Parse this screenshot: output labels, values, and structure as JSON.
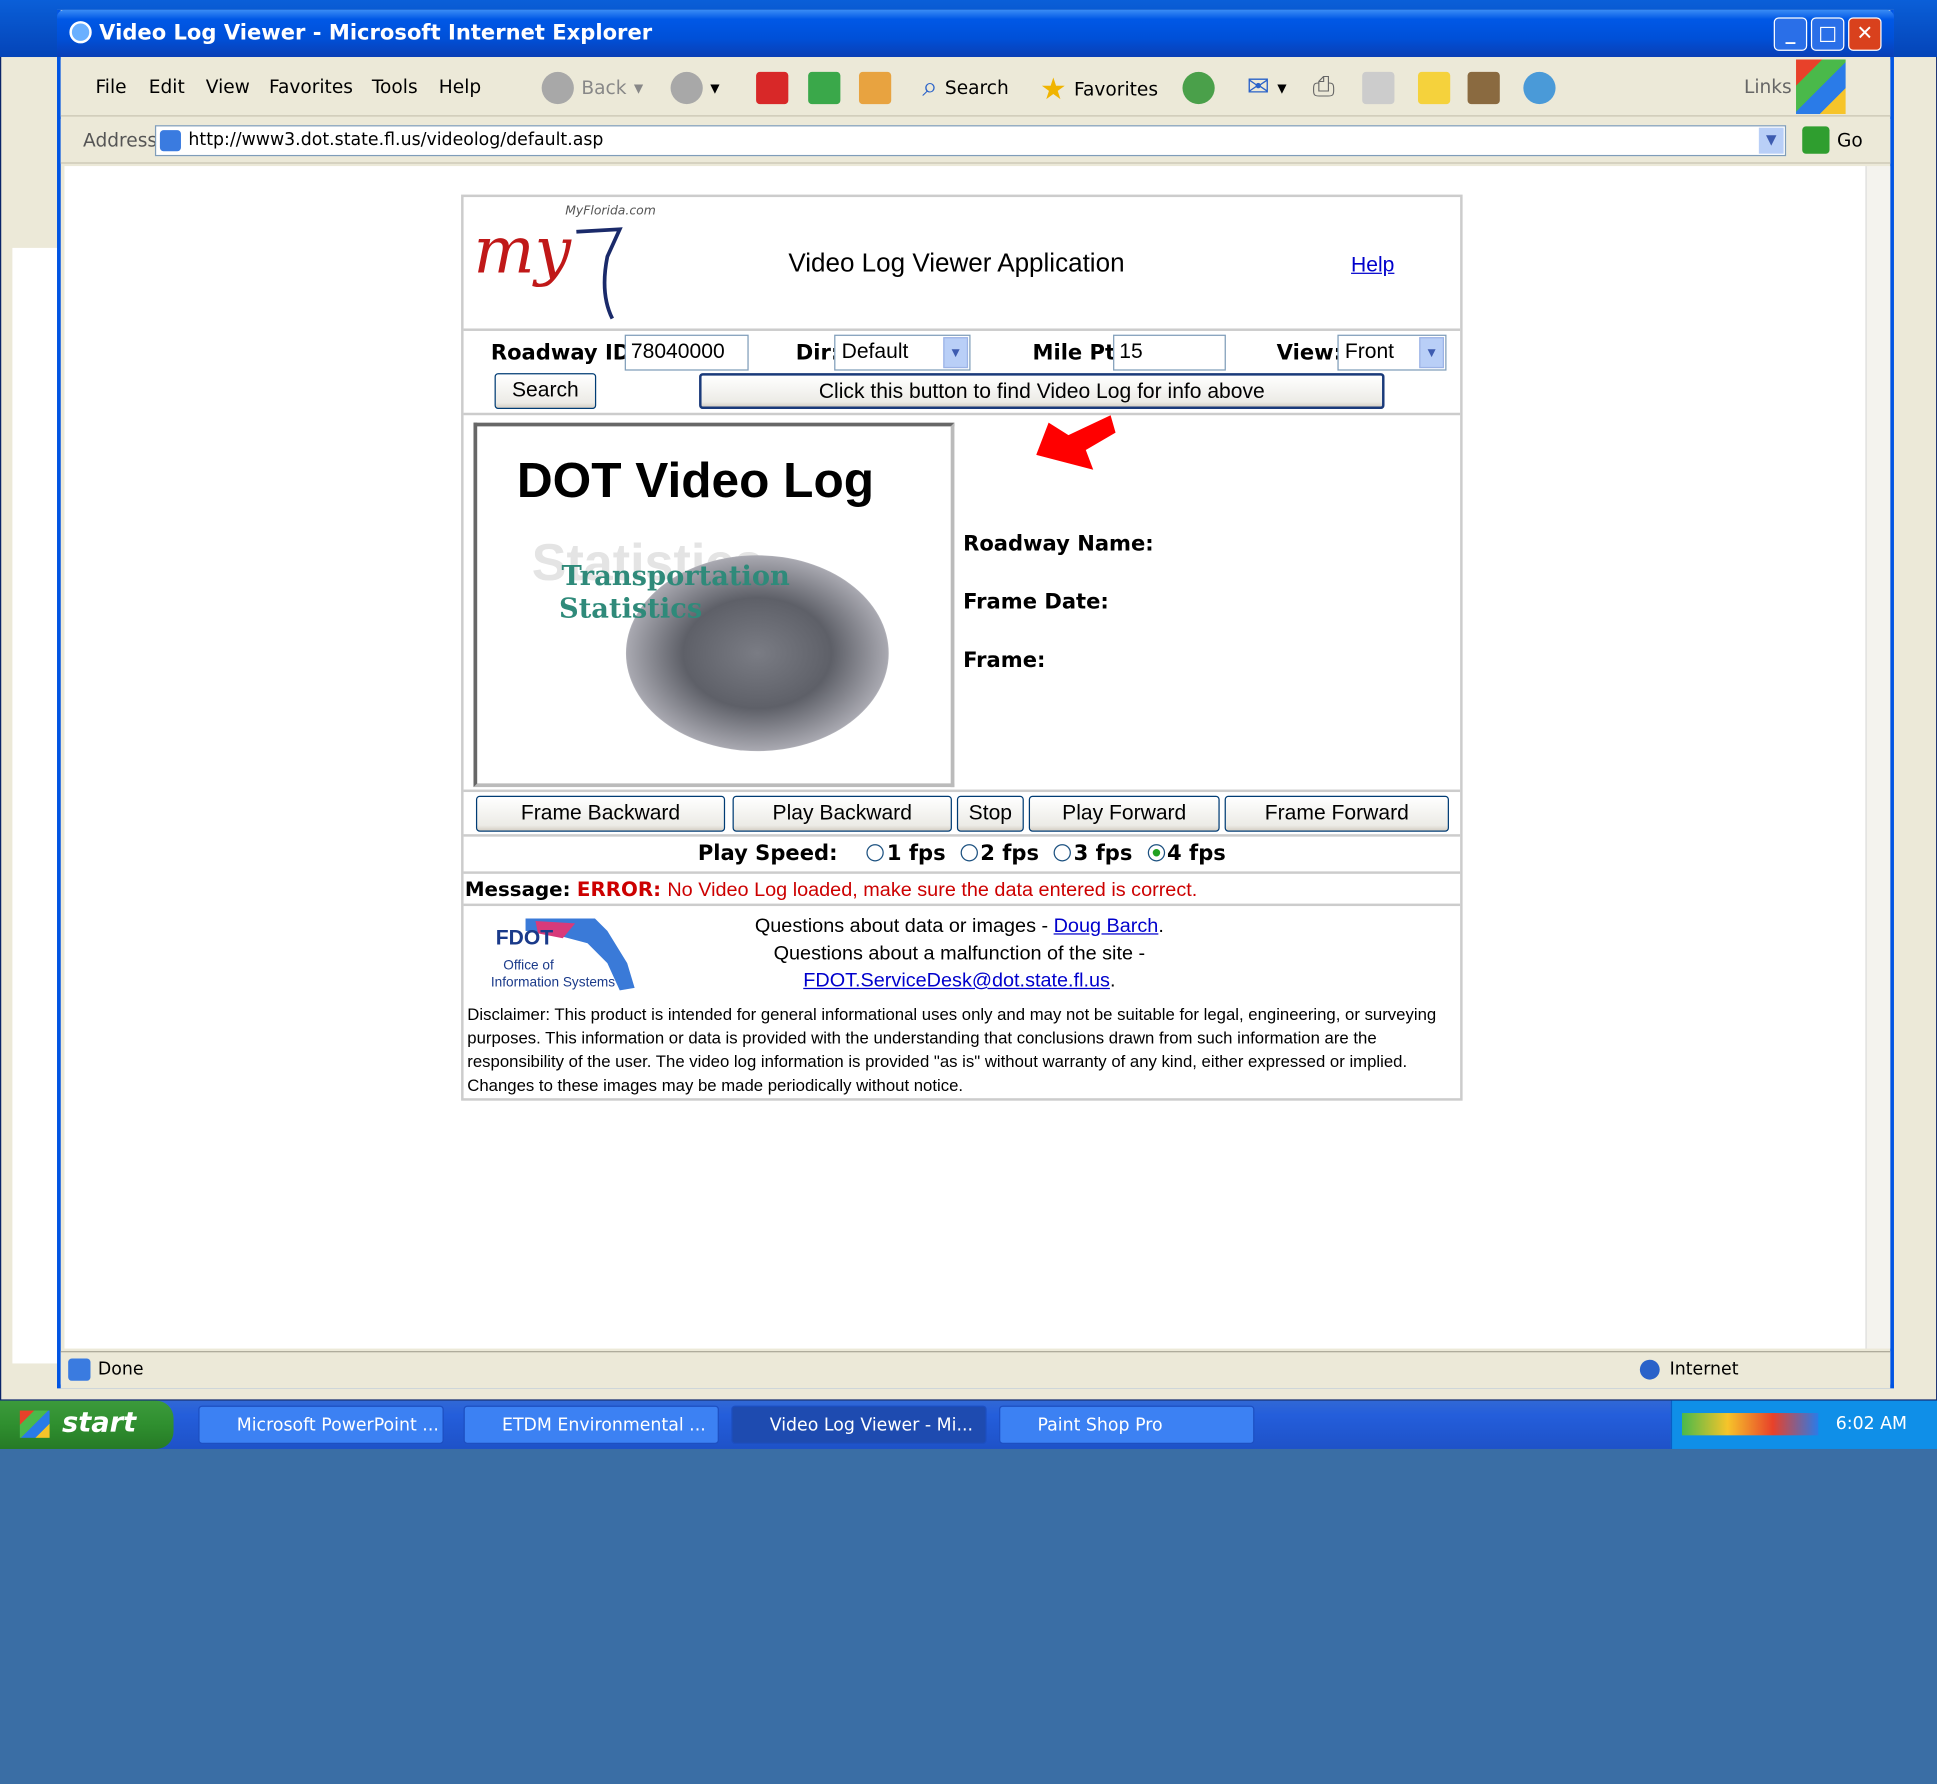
{
  "window": {
    "title": "Video Log Viewer - Microsoft Internet Explorer",
    "menu": [
      "File",
      "Edit",
      "View",
      "Favorites",
      "Tools",
      "Help"
    ],
    "toolbar": {
      "back": "Back",
      "search": "Search",
      "favorites": "Favorites",
      "links": "Links",
      "go": "Go"
    },
    "address_label": "Address",
    "address_url": "http://www3.dot.state.fl.us/videolog/default.asp",
    "status_text": "Done",
    "zone_text": "Internet"
  },
  "page": {
    "logo_brand": "MyFlorida.com",
    "logo_text": "my",
    "app_title": "Video Log Viewer Application",
    "help_link": "Help",
    "form": {
      "roadway_label": "Roadway ID:",
      "roadway_value": "78040000",
      "dir_label": "Dir:",
      "dir_value": "Default",
      "milept_label": "Mile Pt:",
      "milept_value": "15",
      "view_label": "View:",
      "view_value": "Front",
      "search_button": "Search",
      "find_button": "Click this button to find Video Log for info above"
    },
    "video": {
      "heading": "DOT Video Log",
      "subtitle_line1": "Transportation",
      "subtitle_line2": "Statistics",
      "watermark": "Statistics"
    },
    "info": {
      "roadway_name_label": "Roadway Name:",
      "frame_date_label": "Frame Date:",
      "frame_label": "Frame:"
    },
    "controls": [
      "Frame Backward",
      "Play Backward",
      "Stop",
      "Play Forward",
      "Frame Forward"
    ],
    "speed": {
      "label": "Play Speed:",
      "options": [
        "1 fps",
        "2 fps",
        "3 fps",
        "4 fps"
      ],
      "selected": "4 fps"
    },
    "message": {
      "label": "Message:",
      "error": "ERROR:",
      "text": "No Video Log loaded, make sure the data entered is correct."
    },
    "footer": {
      "fdot": "FDOT",
      "office1": "Office of",
      "office2": "Information Systems",
      "q1_prefix": "Questions about data or images - ",
      "q1_link": "Doug Barch",
      "q1_suffix": ".",
      "q2": "Questions about a malfunction of the site -",
      "q2_link": "FDOT.ServiceDesk@dot.state.fl.us",
      "q2_suffix": ".",
      "disclaimer": "Disclaimer: This product is intended for general informational uses only and may not be suitable for legal, engineering, or surveying purposes. This information or data is provided with the understanding that conclusions drawn from such information are the responsibility of the user. The video log information is provided \"as is\" without warranty of any kind, either expressed or implied. Changes to these images may be made periodically without notice."
    }
  },
  "taskbar": {
    "start": "start",
    "tasks": [
      "Microsoft PowerPoint ...",
      "ETDM Environmental ...",
      "Video Log Viewer - Mi...",
      "Paint Shop Pro"
    ],
    "clock": "6:02 AM"
  },
  "colors": {
    "accent": "#0054e3",
    "error": "#cc0000",
    "link": "#0000cc"
  }
}
